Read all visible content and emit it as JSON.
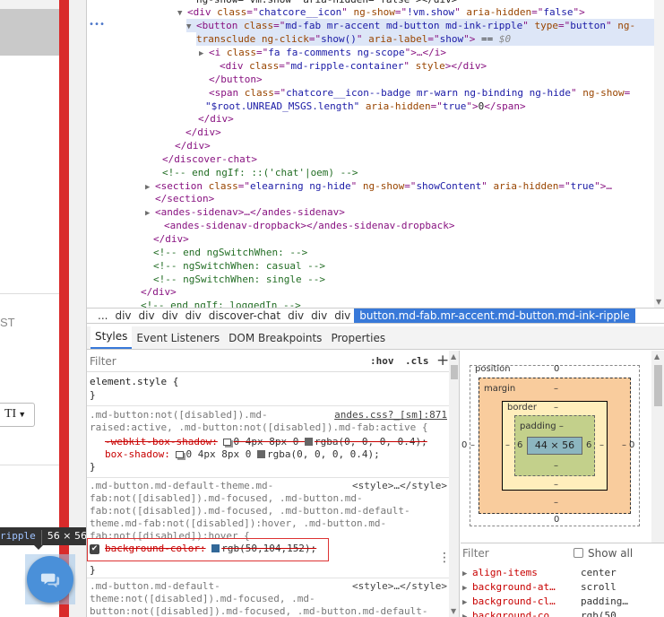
{
  "page": {
    "st_text": "ST",
    "ti_button_label": "TI",
    "tooltip_selector": "ripple",
    "tooltip_dims": "56 × 56"
  },
  "dom_tree": {
    "lines": [
      {
        "segs": [
          [
            "t",
            "ng-show=\"vm.show\" aria-hidden=\"false\"></div>"
          ]
        ]
      },
      {
        "segs": [
          [
            "g",
            "<div "
          ],
          [
            "a",
            "class"
          ],
          [
            "g",
            "=\""
          ],
          [
            "v",
            "chatcore__icon"
          ],
          [
            "g",
            "\" "
          ],
          [
            "a",
            "ng-show"
          ],
          [
            "g",
            "=\""
          ],
          [
            "v",
            "!vm.show"
          ],
          [
            "g",
            "\" "
          ],
          [
            "a",
            "aria-hidden"
          ],
          [
            "g",
            "=\""
          ],
          [
            "v",
            "false"
          ],
          [
            "g",
            "\">"
          ]
        ]
      },
      {
        "segs": [
          [
            "g",
            "<button "
          ],
          [
            "a",
            "class"
          ],
          [
            "g",
            "=\""
          ],
          [
            "v",
            "md-fab mr-accent md-button md-ink-ripple"
          ],
          [
            "g",
            "\" "
          ],
          [
            "a",
            "type"
          ],
          [
            "g",
            "=\""
          ],
          [
            "v",
            "button"
          ],
          [
            "g",
            "\" "
          ],
          [
            "a",
            "ng-"
          ]
        ]
      },
      {
        "segs": [
          [
            "a",
            "transclude"
          ],
          [
            "g",
            " "
          ],
          [
            "a",
            "ng-click"
          ],
          [
            "g",
            "=\""
          ],
          [
            "v",
            "show()"
          ],
          [
            "g",
            "\" "
          ],
          [
            "a",
            "aria-label"
          ],
          [
            "g",
            "=\""
          ],
          [
            "v",
            "show"
          ],
          [
            "g",
            "\">"
          ],
          [
            "t",
            " == "
          ],
          [
            "x",
            "$0"
          ]
        ]
      },
      {
        "segs": [
          [
            "g",
            "<i "
          ],
          [
            "a",
            "class"
          ],
          [
            "g",
            "=\""
          ],
          [
            "v",
            "fa fa-comments ng-scope"
          ],
          [
            "g",
            "\">…</i>"
          ]
        ]
      },
      {
        "segs": [
          [
            "g",
            "<div "
          ],
          [
            "a",
            "class"
          ],
          [
            "g",
            "=\""
          ],
          [
            "v",
            "md-ripple-container"
          ],
          [
            "g",
            "\" "
          ],
          [
            "a",
            "style"
          ],
          [
            "g",
            "></div>"
          ]
        ]
      },
      {
        "segs": [
          [
            "g",
            "</button>"
          ]
        ]
      },
      {
        "segs": [
          [
            "g",
            "<span "
          ],
          [
            "a",
            "class"
          ],
          [
            "g",
            "=\""
          ],
          [
            "v",
            "chatcore__icon--badge mr-warn ng-binding ng-hide"
          ],
          [
            "g",
            "\" "
          ],
          [
            "a",
            "ng-show"
          ],
          [
            "g",
            "="
          ]
        ]
      },
      {
        "segs": [
          [
            "v",
            "\"$root.UNREAD_MSGS.length\""
          ],
          [
            "g",
            " "
          ],
          [
            "a",
            "aria-hidden"
          ],
          [
            "g",
            "=\""
          ],
          [
            "v",
            "true"
          ],
          [
            "g",
            "\">"
          ],
          [
            "t",
            "0"
          ],
          [
            "g",
            "</span>"
          ]
        ]
      },
      {
        "segs": [
          [
            "g",
            "</div>"
          ]
        ]
      },
      {
        "segs": [
          [
            "g",
            "</div>"
          ]
        ]
      },
      {
        "segs": [
          [
            "g",
            "</div>"
          ]
        ]
      },
      {
        "segs": [
          [
            "g",
            "</discover-chat>"
          ]
        ]
      },
      {
        "segs": [
          [
            "c",
            "<!-- end ngIf: ::('chat'|oem) -->"
          ]
        ]
      },
      {
        "segs": [
          [
            "g",
            "<section "
          ],
          [
            "a",
            "class"
          ],
          [
            "g",
            "=\""
          ],
          [
            "v",
            "elearning ng-hide"
          ],
          [
            "g",
            "\" "
          ],
          [
            "a",
            "ng-show"
          ],
          [
            "g",
            "=\""
          ],
          [
            "v",
            "showContent"
          ],
          [
            "g",
            "\" "
          ],
          [
            "a",
            "aria-hidden"
          ],
          [
            "g",
            "=\""
          ],
          [
            "v",
            "true"
          ],
          [
            "g",
            "\">…"
          ]
        ]
      },
      {
        "segs": [
          [
            "g",
            "</section>"
          ]
        ]
      },
      {
        "segs": [
          [
            "g",
            "<andes-sidenav>…</andes-sidenav>"
          ]
        ]
      },
      {
        "segs": [
          [
            "g",
            "<andes-sidenav-dropback></andes-sidenav-dropback>"
          ]
        ]
      },
      {
        "segs": [
          [
            "g",
            "</div>"
          ]
        ]
      },
      {
        "segs": [
          [
            "c",
            "<!-- end ngSwitchWhen: -->"
          ]
        ]
      },
      {
        "segs": [
          [
            "c",
            "<!-- ngSwitchWhen: casual -->"
          ]
        ]
      },
      {
        "segs": [
          [
            "c",
            "<!-- ngSwitchWhen: single -->"
          ]
        ]
      },
      {
        "segs": [
          [
            "g",
            "</div>"
          ]
        ]
      },
      {
        "segs": [
          [
            "c",
            "<!-- end ngIf: loggedIn -->"
          ]
        ]
      }
    ]
  },
  "breadcrumb": [
    "...",
    "div",
    "div",
    "div",
    "div",
    "discover-chat",
    "div",
    "div",
    "div",
    "button.md-fab.mr-accent.md-button.md-ink-ripple"
  ],
  "tabs": [
    "Styles",
    "Event Listeners",
    "DOM Breakpoints",
    "Properties"
  ],
  "styles": {
    "filter_placeholder": "Filter",
    "hov": ":hov",
    "cls": ".cls",
    "plus": "+",
    "rules": {
      "element_style": "element.style {",
      "close": "}",
      "r1_sel_1": ".md-button:not([disabled]).md-",
      "r1_sel_2": "raised:active, .md-button:not([disabled]).md-fab:active {",
      "r1_src": "andes.css?_[sm]:871",
      "r1_p1_name": "-webkit-box-shadow:",
      "r1_p1_val": "0 4px 8px 0 ",
      "r1_p1_color": "rgba(0, 0, 0, 0.4);",
      "r1_p2_name": "box-shadow:",
      "r1_p2_val": "0 4px 8px 0 ",
      "r1_p2_color": "rgba(0, 0, 0, 0.4);",
      "r2_sel_1": ".md-button.md-default-theme.md-",
      "r2_sel_2": "fab:not([disabled]).md-focused, .md-button.md-",
      "r2_sel_3": "fab:not([disabled]).md-focused, .md-button.md-default-",
      "r2_sel_4": "theme.md-fab:not([disabled]):hover, .md-button.md-",
      "r2_sel_5": "fab:not([disabled]):hover {",
      "r2_src": "<style>…</style>",
      "r2_p1_name": "background-color:",
      "r2_p1_val": "rgb(50,104,152);",
      "r3_sel_1": ".md-button.md-default-",
      "r3_sel_2": "theme:not([disabled]).md-focused, .md-",
      "r3_sel_3": "button:not([disabled]).md-focused, .md-button.md-default-",
      "r3_src": "<style>…</style>"
    }
  },
  "boxmodel": {
    "position_label": "position",
    "position_val": "0",
    "margin_label": "margin",
    "margin_val": "–",
    "border_label": "border",
    "border_val": "–",
    "padding_label": "padding –",
    "content": "44 × 56",
    "side_pos": "0",
    "side_margin": "–",
    "side_border": "–",
    "side_padding": "6",
    "bottom_padding": "–",
    "bottom_border": "–",
    "bottom_margin": "–",
    "bottom_pos": "0"
  },
  "computed": {
    "filter_placeholder": "Filter",
    "show_all": "Show all",
    "rows": [
      {
        "name": "align-items",
        "value": "center"
      },
      {
        "name": "background-at…",
        "value": "scroll"
      },
      {
        "name": "background-cl…",
        "value": "padding…"
      },
      {
        "name": "background-co…",
        "value": "rgb(50…"
      }
    ]
  },
  "colors": {
    "accent": "#3879d9",
    "fab": "#4a90d9",
    "bg_swatch": "#326898",
    "shadow_swatch": "#666666"
  }
}
